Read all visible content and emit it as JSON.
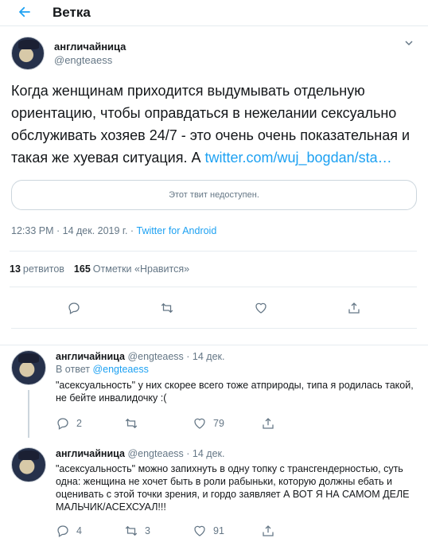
{
  "header": {
    "title": "Ветка"
  },
  "tweet": {
    "display_name": "англичайница",
    "handle": "@engteaess",
    "text": "Когда женщинам приходится выдумывать отдельную ориентацию, чтобы оправдаться в нежелании сексуально обслуживать хозяев 24/7 - это очень очень показательная и такая же хуевая ситуация. А ",
    "link": "twitter.com/wuj_bogdan/sta…",
    "unavailable": "Этот твит недоступен.",
    "timestamp": "12:33 PM · 14 дек. 2019 г. · ",
    "source": "Twitter for Android",
    "retweets_count": "13",
    "retweets_label": "ретвитов",
    "likes_count": "165",
    "likes_label": "Отметки «Нравится»"
  },
  "replies": [
    {
      "display_name": "англичайница",
      "meta": "@engteaess · 14 дек.",
      "in_reply_label": "В ответ ",
      "in_reply_mention": "@engteaess",
      "text": "\"асексуальность\" у них скорее всего тоже атприроды, типа я родилась такой, не бейте инвалидочку :(",
      "replies_count": "2",
      "retweets_count": "",
      "likes_count": "79"
    },
    {
      "display_name": "англичайница",
      "meta": "@engteaess · 14 дек.",
      "text": "\"асексуальность\" можно запихнуть в одну топку с трансгендерностью, суть одна: женщина не хочет быть в роли рабыньки, которую должны ебать и оценивать с этой точки зрения, и гордо заявляет А ВОТ Я НА САМОМ ДЕЛЕ МАЛЬЧИК/АСЕХСУАЛ!!!",
      "replies_count": "4",
      "retweets_count": "3",
      "likes_count": "91"
    }
  ],
  "icons": {
    "back": "back-arrow-icon",
    "caret": "chevron-down-icon",
    "reply": "reply-icon",
    "retweet": "retweet-icon",
    "like": "heart-icon",
    "share": "share-icon"
  },
  "colors": {
    "accent": "#1da1f2",
    "muted": "#657786",
    "text": "#14171a",
    "border": "#e6ecf0"
  }
}
